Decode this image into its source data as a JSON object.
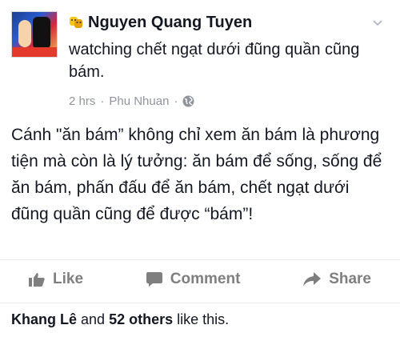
{
  "author": {
    "name": "Nguyen Quang Tuyen"
  },
  "activity": {
    "text": "watching chết ngạt dưới đũng quần cũng bám."
  },
  "meta": {
    "time": "2 hrs",
    "separator": "·",
    "location": "Phu Nhuan",
    "separator2": "·"
  },
  "post": {
    "text": "Cánh \"ăn bám” không chỉ xem ăn bám là phương tiện mà còn là lý tưởng: ăn bám để sống, sống để ăn bám, phấn đấu để ăn bám, chết ngạt dưới đũng quần cũng để được “bám”!"
  },
  "actions": {
    "like": "Like",
    "comment": "Comment",
    "share": "Share"
  },
  "likes": {
    "name": "Khang Lê",
    "and": "and",
    "count": "52 others",
    "suffix": "like this."
  },
  "icons": {
    "avatar": "profile-photo",
    "activity": "theater-masks-icon",
    "menu": "chevron-down-icon",
    "privacy": "globe-icon",
    "like": "thumbs-up-icon",
    "comment": "comment-bubble-icon",
    "share": "share-arrow-icon"
  },
  "colors": {
    "text": "#141823",
    "muted": "#90949c",
    "action": "#7f7f7f",
    "divider": "#e9ebee"
  }
}
